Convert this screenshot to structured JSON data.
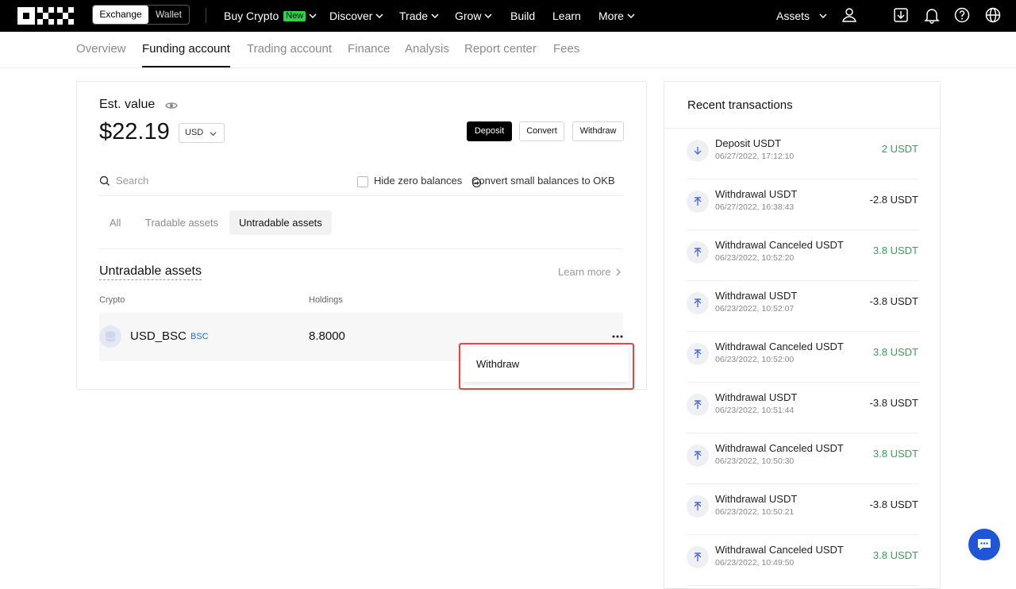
{
  "topnav": {
    "exchange": "Exchange",
    "wallet": "Wallet",
    "buy_crypto": "Buy Crypto",
    "new_badge": "New",
    "discover": "Discover",
    "trade": "Trade",
    "grow": "Grow",
    "build": "Build",
    "learn": "Learn",
    "more": "More",
    "assets": "Assets",
    "icons": [
      "user-icon",
      "download-icon",
      "bell-icon",
      "help-icon",
      "globe-icon"
    ]
  },
  "subnav": {
    "tabs": [
      "Overview",
      "Funding account",
      "Trading account",
      "Finance",
      "Analysis",
      "Report center",
      "Fees"
    ],
    "active": "Funding account"
  },
  "funding": {
    "est_label": "Est. value",
    "balance": "$22.19",
    "currency": "USD",
    "deposit": "Deposit",
    "convert": "Convert",
    "withdraw": "Withdraw",
    "search_placeholder": "Search",
    "hide_zero": "Hide zero balances",
    "convert_small": "Convert small balances to OKB",
    "filters": [
      "All",
      "Tradable assets",
      "Untradable assets"
    ],
    "active_filter": "Untradable assets",
    "section_title": "Untradable assets",
    "learn_more": "Learn more",
    "col_crypto": "Crypto",
    "col_holdings": "Holdings",
    "row": {
      "name": "USD_BSC",
      "chain": "BSC",
      "holdings": "8.8000"
    },
    "menu_withdraw": "Withdraw"
  },
  "recent": {
    "title": "Recent transactions",
    "items": [
      {
        "type": "deposit",
        "title": "Deposit USDT",
        "time": "06/27/2022, 17:12:10",
        "amount": "2 USDT",
        "positive": true
      },
      {
        "type": "withdraw",
        "title": "Withdrawal USDT",
        "time": "06/27/2022, 16:38:43",
        "amount": "-2.8 USDT",
        "positive": false
      },
      {
        "type": "withdraw",
        "title": "Withdrawal Canceled USDT",
        "time": "06/23/2022, 10:52:20",
        "amount": "3.8 USDT",
        "positive": true
      },
      {
        "type": "withdraw",
        "title": "Withdrawal USDT",
        "time": "06/23/2022, 10:52:07",
        "amount": "-3.8 USDT",
        "positive": false
      },
      {
        "type": "withdraw",
        "title": "Withdrawal Canceled USDT",
        "time": "06/23/2022, 10:52:00",
        "amount": "3.8 USDT",
        "positive": true
      },
      {
        "type": "withdraw",
        "title": "Withdrawal USDT",
        "time": "06/23/2022, 10:51:44",
        "amount": "-3.8 USDT",
        "positive": false
      },
      {
        "type": "withdraw",
        "title": "Withdrawal Canceled USDT",
        "time": "06/23/2022, 10:50:30",
        "amount": "3.8 USDT",
        "positive": true
      },
      {
        "type": "withdraw",
        "title": "Withdrawal USDT",
        "time": "06/23/2022, 10:50:21",
        "amount": "-3.8 USDT",
        "positive": false
      },
      {
        "type": "withdraw",
        "title": "Withdrawal Canceled USDT",
        "time": "06/23/2022, 10:49:50",
        "amount": "3.8 USDT",
        "positive": true
      }
    ]
  },
  "colors": {
    "positive": "#2ea44f",
    "chain": "#1a6fe6",
    "highlight": "#e74545",
    "chat": "#1f56d6",
    "new_badge": "#2bd24a"
  }
}
